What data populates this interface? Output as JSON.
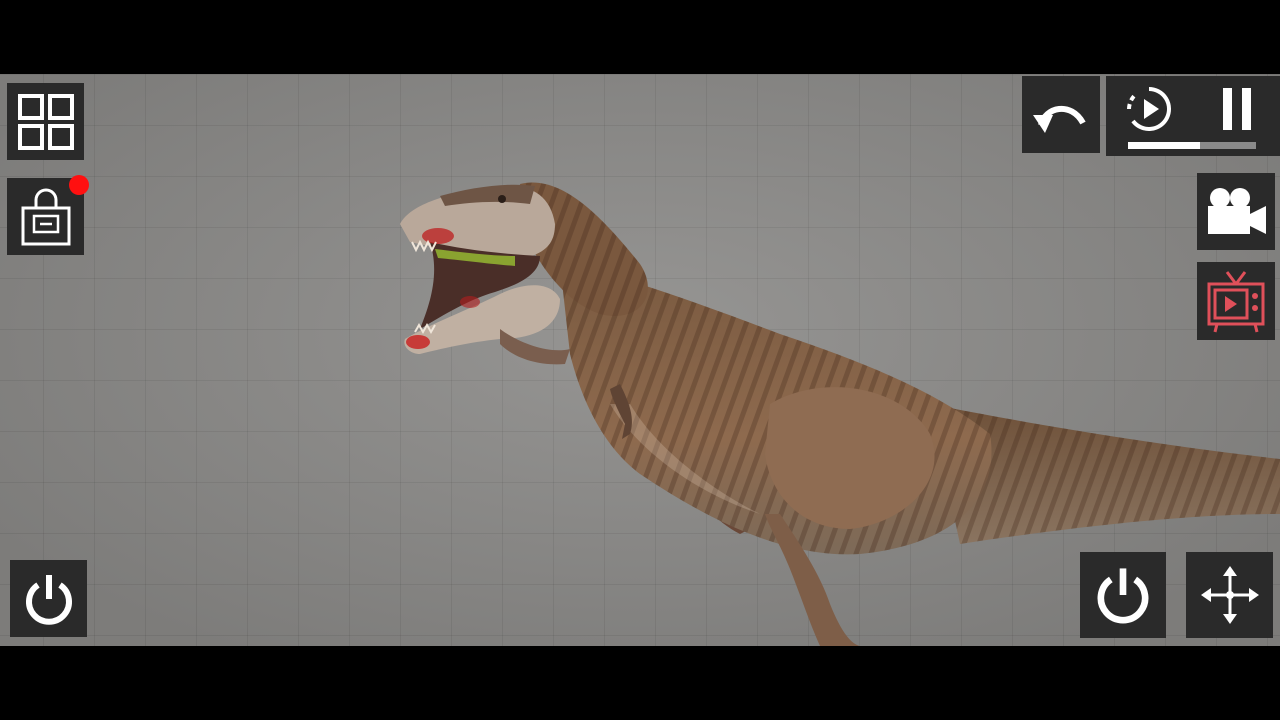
{
  "hud": {
    "menu_icon": "grid-menu-icon",
    "inventory_icon": "locked-bag-icon",
    "inventory_badge_color": "#ff1010",
    "undo_icon": "undo-arrow-icon",
    "slowmo_icon": "slow-motion-icon",
    "pause_icon": "pause-icon",
    "time_speed_fraction": 0.56,
    "camera_icon": "video-camera-icon",
    "tv_icon": "retro-tv-icon",
    "power_left_icon": "power-icon",
    "power_right_icon": "power-icon",
    "move_icon": "move-arrows-icon"
  },
  "colors": {
    "button_bg": "#2a2a2a",
    "icon_fg": "#ffffff",
    "tv_icon_color": "#e0505a",
    "grid_bg": "#8e8d8b"
  }
}
